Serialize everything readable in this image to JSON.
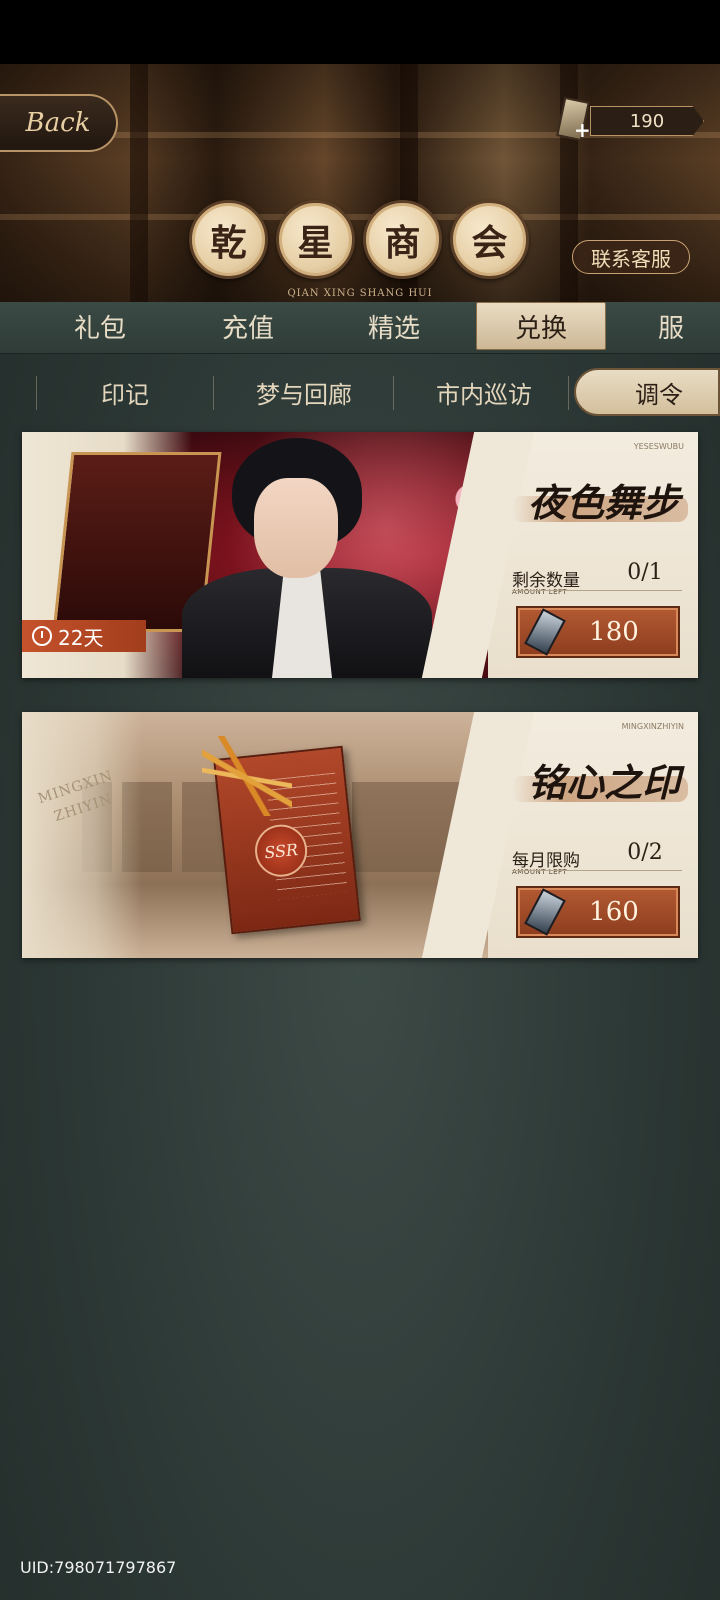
{
  "header": {
    "back_label": "Back",
    "currency_amount": "190",
    "title_chars": [
      "乾",
      "星",
      "商",
      "会"
    ],
    "service_label": "联系客服",
    "pinyin": "QIAN XING SHANG HUI"
  },
  "main_tabs": [
    {
      "label": "礼包",
      "active": false
    },
    {
      "label": "充值",
      "active": false
    },
    {
      "label": "精选",
      "active": false
    },
    {
      "label": "兑换",
      "active": true
    },
    {
      "label": "服",
      "active": false
    }
  ],
  "sub_tabs": [
    {
      "label": "印记",
      "active": false
    },
    {
      "label": "梦与回廊",
      "active": false
    },
    {
      "label": "市内巡访",
      "active": false
    },
    {
      "label": "调令",
      "active": true
    }
  ],
  "cards": [
    {
      "name": "夜色舞步",
      "tag": "YESESWUBU",
      "qty_label": "剩余数量",
      "qty_sub": "AMOUNT LEFT",
      "qty_value": "0/1",
      "price": "180",
      "timer": "22天"
    },
    {
      "name": "铭心之印",
      "tag": "MINGXINZHIYIN",
      "art_text_1": "MINGXIN",
      "art_text_2": "ZHIYIN",
      "seal_text": "SSR",
      "qty_label": "每月限购",
      "qty_sub": "AMOUNT LEFT",
      "qty_value": "0/2",
      "price": "160"
    }
  ],
  "footer": {
    "uid": "UID:798071797867"
  }
}
